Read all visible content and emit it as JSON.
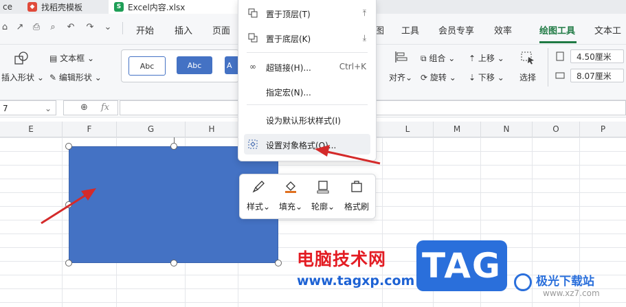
{
  "tabs": [
    {
      "label": "ce"
    },
    {
      "label": "找稻壳模板",
      "icon": "docer-icon"
    },
    {
      "label": "Excel内容.xlsx",
      "icon": "sheet-icon"
    }
  ],
  "menubar": {
    "items": [
      "开始",
      "插入",
      "页面",
      "图",
      "工具",
      "会员专享",
      "效率",
      "绘图工具",
      "文本工"
    ],
    "active": "绘图工具"
  },
  "ribbon": {
    "insert_shape": "插入形状",
    "text_box": "文本框",
    "edit_shape": "编辑形状",
    "style_samples": [
      "Abc",
      "Abc",
      "A"
    ],
    "combine": "组合",
    "rotate": "旋转",
    "bring_up": "上移",
    "send_down": "下移",
    "align": "对齐",
    "select": "选择",
    "height_value": "4.50厘米",
    "width_value": "8.07厘米"
  },
  "formula_bar": {
    "name_box": "7",
    "fx_label": "fx"
  },
  "columns": [
    "E",
    "F",
    "G",
    "H",
    "L",
    "M",
    "N",
    "O",
    "P"
  ],
  "context_menu": {
    "items": [
      {
        "label": "置于顶层(T)",
        "shortcut": ""
      },
      {
        "label": "置于底层(K)",
        "shortcut": ""
      },
      {
        "label": "超链接(H)...",
        "shortcut": "Ctrl+K"
      },
      {
        "label": "指定宏(N)...",
        "shortcut": ""
      },
      {
        "label": "设为默认形状样式(I)",
        "shortcut": ""
      },
      {
        "label": "设置对象格式(O)...",
        "shortcut": ""
      }
    ]
  },
  "float_toolbar": {
    "items": [
      "样式",
      "填充",
      "轮廓",
      "格式刷"
    ]
  },
  "watermark": {
    "title": "电脑技术网",
    "url": "www.tagxp.com",
    "tag": "TAG",
    "site": "极光下载站",
    "site_url": "www.xz7.com"
  },
  "colors": {
    "shape_fill": "#4472c4",
    "accent_green": "#1f7a44",
    "arrow_red": "#d42a2a"
  }
}
